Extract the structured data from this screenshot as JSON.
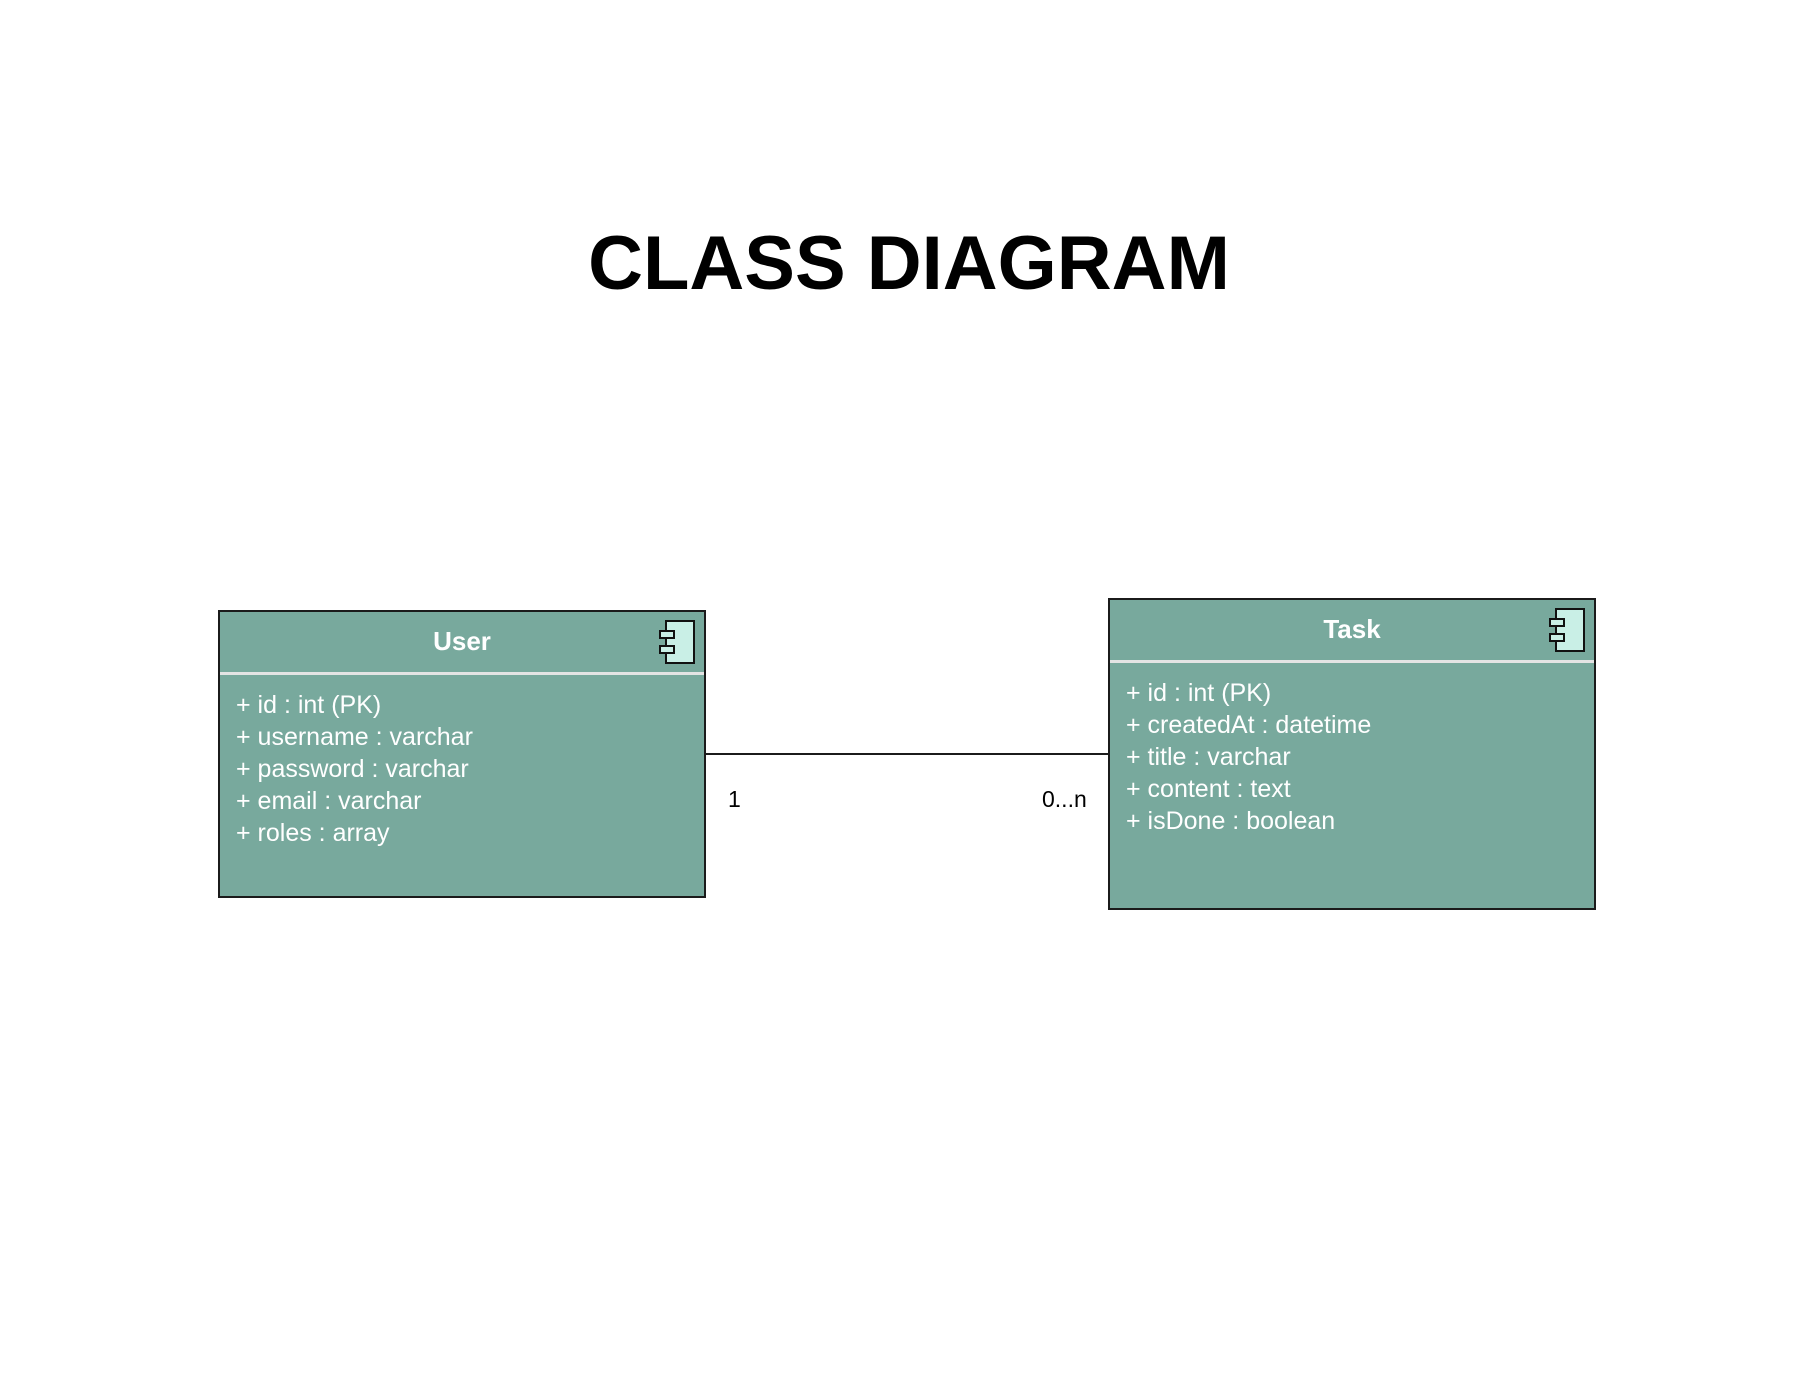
{
  "title": "CLASS DIAGRAM",
  "colors": {
    "class_fill": "#78a99d",
    "class_border": "#1b1b1b",
    "header_divider": "#e4e4e4",
    "icon_fill": "#c9efe6",
    "text_on_class": "#ffffff"
  },
  "classes": [
    {
      "name": "User",
      "icon": "component-icon",
      "attributes": [
        "+ id : int (PK)",
        "+ username : varchar",
        "+ password : varchar",
        "+ email : varchar",
        "+ roles : array"
      ]
    },
    {
      "name": "Task",
      "icon": "component-icon",
      "attributes": [
        "+ id : int (PK)",
        "+ createdAt : datetime",
        "+ title : varchar",
        "+ content : text",
        "+ isDone : boolean"
      ]
    }
  ],
  "association": {
    "from": "User",
    "to": "Task",
    "from_multiplicity": "1",
    "to_multiplicity": "0...n"
  }
}
